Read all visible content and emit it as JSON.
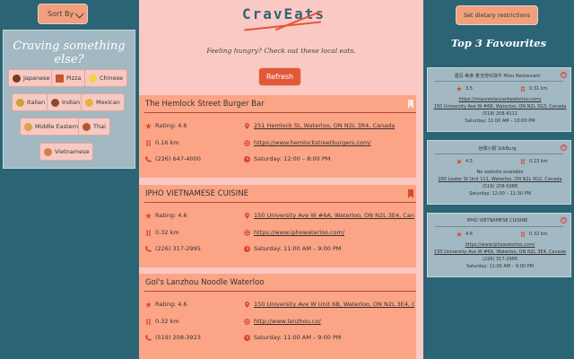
{
  "sort": {
    "label": "Sort By"
  },
  "craving": {
    "title": "Craving something else?",
    "chips": [
      "Japanese",
      "Pizza",
      "Chinese",
      "Italian",
      "Indian",
      "Mexican",
      "Middle Eastern",
      "Thai",
      "Vietnamese"
    ]
  },
  "header": {
    "logo": "CravEats",
    "tagline": "Feeling hungry? Check out these local eats.",
    "refresh_label": "Refresh"
  },
  "restaurants": [
    {
      "name": "The Hemlock Street Burger Bar",
      "rating": "Rating: 4.6",
      "distance": "0.16 km",
      "phone": "(226) 647-4000",
      "address": "251 Hemlock St, Waterloo, ON N2L 3R4, Canada",
      "website": "https://www.hemlockstreetburgers.com/",
      "hours": "Saturday: 12:00 – 8:00 PM"
    },
    {
      "name": "IPHO VIETNAMESE CUISINE",
      "rating": "Rating: 4.6",
      "distance": "0.32 km",
      "phone": "(226) 317-2995",
      "address": "150 University Ave W #6A, Waterloo, ON N2L 3E4, Canada",
      "website": "https://www.iphowaterloo.com/",
      "hours": "Saturday: 11:00 AM – 9:00 PM"
    },
    {
      "name": "Gol's Lanzhou Noodle Waterloo",
      "rating": "Rating: 4.6",
      "distance": "0.32 km",
      "phone": "(519) 208-3923",
      "address": "150 University Ave W Unit 6B, Waterloo, ON N2L 3E4, Can...",
      "website": "http://www.lanzhou.co/",
      "hours": "Saturday: 11:00 AM – 9:00 PM"
    }
  ],
  "diet": {
    "label": "Set dietary restrictions"
  },
  "favourites": {
    "title": "Top 3 Favourites",
    "items": [
      {
        "name": "遇见·美食 麦当劳红烧牛 Miau Restaurant",
        "rating": "3.5",
        "distance": "0.31 km",
        "website": "https://miaurestaurantwaterloo.com/",
        "address": "150 University Ave W #6B, Waterloo, ON N2L 3G3, Canada",
        "phone": "(519) 208-8111",
        "hours": "Saturday: 11:00 AM – 10:00 PM"
      },
      {
        "name": "丝缕小厨 SilkBurg",
        "rating": "4.5",
        "distance": "0.23 km",
        "website": "No website available",
        "address": "260 Lester St Unit 111, Waterloo, ON N2L 0G2, Canada",
        "phone": "(519) 208-5088",
        "hours": "Saturday: 12:00 – 11:30 PM"
      },
      {
        "name": "IPHO VIETNAMESE CUISINE",
        "rating": "4.6",
        "distance": "0.32 km",
        "website": "https://www.iphowaterloo.com/",
        "address": "150 University Ave W #6A, Waterloo, ON N2L 3E4, Canada",
        "phone": "(226) 317-2995",
        "hours": "Saturday: 11:00 AM – 9:00 PM"
      }
    ]
  },
  "colors": {
    "background": "#2b6474",
    "panel": "#fbc9c3",
    "card": "#fba486",
    "accent": "#e3583b",
    "teal_text": "#2e6376"
  }
}
